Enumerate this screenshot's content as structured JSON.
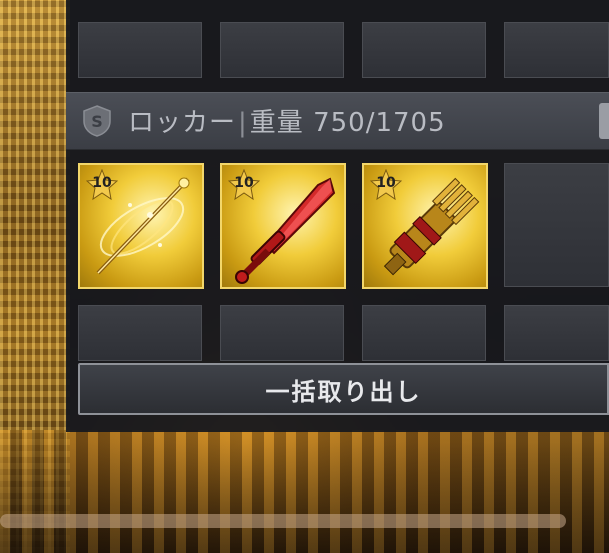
{
  "locker": {
    "title": "ロッカー",
    "separator": "|",
    "weight_label": "重量",
    "weight_value": "750/1705"
  },
  "items": [
    {
      "level": "10",
      "weapon": "golden-staff-icon",
      "color": "#f1cc3a"
    },
    {
      "level": "10",
      "weapon": "crimson-sword-icon",
      "color": "#d42a2a"
    },
    {
      "level": "10",
      "weapon": "golden-gatling-gun-icon",
      "color": "#c8911c"
    }
  ],
  "actions": {
    "take_all_label": "一括取り出し"
  },
  "colors": {
    "panel": "#16181e",
    "rarity_gold": "#f1cc3a",
    "header": "#44474f"
  }
}
